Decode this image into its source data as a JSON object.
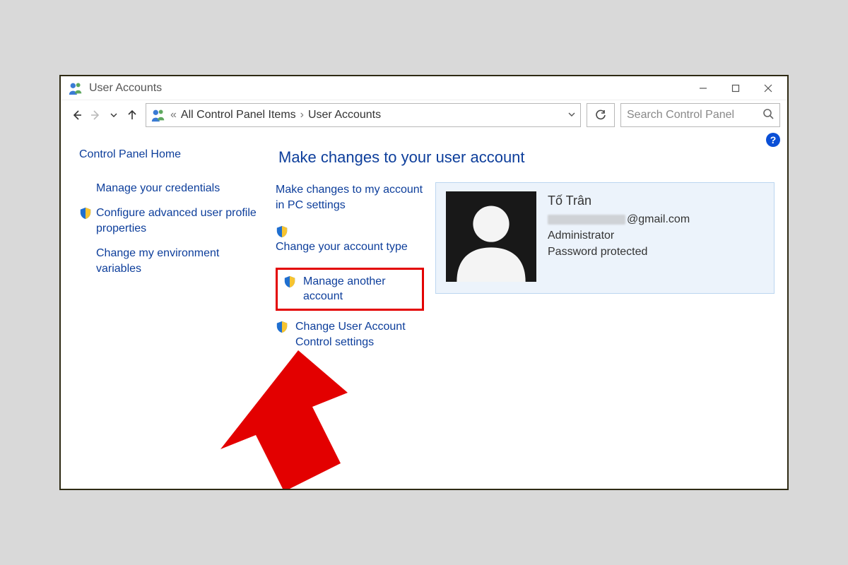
{
  "window": {
    "title": "User Accounts"
  },
  "breadcrumb": {
    "prefix": "«",
    "seg1": "All Control Panel Items",
    "seg2": "User Accounts"
  },
  "search": {
    "placeholder": "Search Control Panel"
  },
  "sidebar": {
    "home": "Control Panel Home",
    "items": [
      {
        "label": "Manage your credentials",
        "shield": false
      },
      {
        "label": "Configure advanced user profile properties",
        "shield": true
      },
      {
        "label": "Change my environment variables",
        "shield": false
      }
    ]
  },
  "main": {
    "heading": "Make changes to your user account",
    "actions": [
      {
        "label": "Make changes to my account in PC settings",
        "shield": false,
        "highlight": false
      },
      {
        "label": "Change your account type",
        "shield": true,
        "highlight": false
      },
      {
        "label": "Manage another account",
        "shield": true,
        "highlight": true
      },
      {
        "label": "Change User Account Control settings",
        "shield": true,
        "highlight": false
      }
    ]
  },
  "account": {
    "name": "Tố Trân",
    "email_domain": "@gmail.com",
    "role": "Administrator",
    "password_status": "Password protected"
  },
  "help": {
    "symbol": "?"
  }
}
